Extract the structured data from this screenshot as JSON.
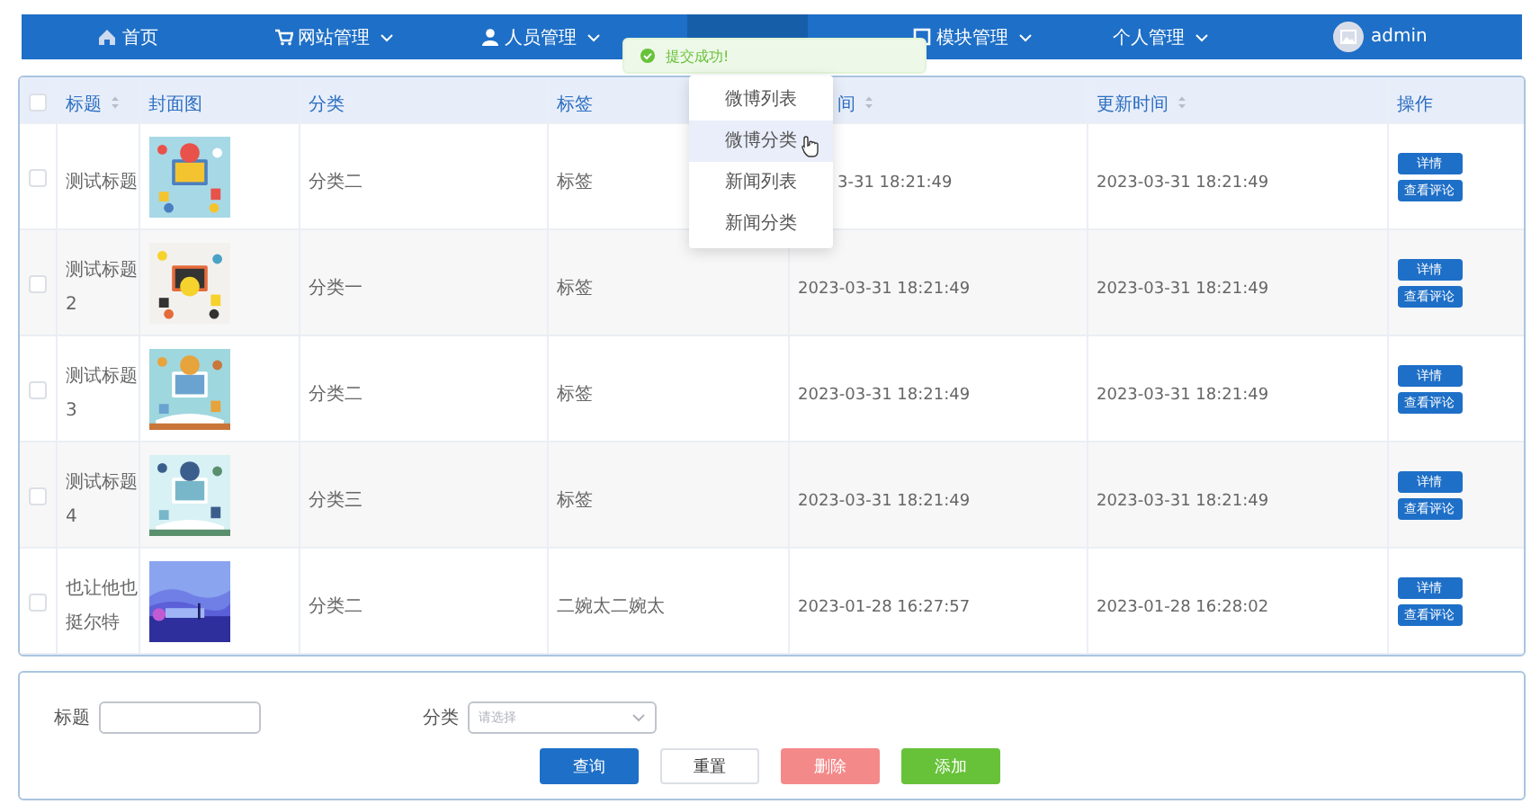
{
  "nav": {
    "items": [
      {
        "label": "首页",
        "dropdown": false,
        "selected": false
      },
      {
        "label": "网站管理",
        "dropdown": true,
        "selected": false
      },
      {
        "label": "人员管理",
        "dropdown": true,
        "selected": false
      },
      {
        "selected": true
      },
      {
        "label": "模块管理",
        "dropdown": true,
        "selected": false
      },
      {
        "label": "个人管理",
        "dropdown": true,
        "selected": false
      }
    ],
    "user": {
      "name": "admin"
    }
  },
  "toast": {
    "message": "提交成功!"
  },
  "dropdown": {
    "items": [
      {
        "label": "微博列表",
        "selected": false
      },
      {
        "label": "微博分类",
        "selected": true
      },
      {
        "label": "新闻列表",
        "selected": false
      },
      {
        "label": "新闻分类",
        "selected": false
      }
    ]
  },
  "table": {
    "header_checked": false,
    "columns": [
      {
        "label": "标题",
        "sortable": true
      },
      {
        "label": "封面图",
        "sortable": false
      },
      {
        "label": "分类",
        "sortable": false
      },
      {
        "label": "标签",
        "sortable": false
      },
      {
        "label": "间",
        "sortable": true
      },
      {
        "label": "更新时间",
        "sortable": true
      },
      {
        "label": "操作",
        "sortable": false
      }
    ],
    "rows": [
      {
        "checked": false,
        "title": "测试标题",
        "category": "分类二",
        "tag": "标签",
        "created": "3-31 18:21:49",
        "updated": "2023-03-31 18:21:49",
        "actions": [
          "详情",
          "查看评论"
        ]
      },
      {
        "checked": false,
        "title": "测试标题2",
        "category": "分类一",
        "tag": "标签",
        "created": "2023-03-31 18:21:49",
        "updated": "2023-03-31 18:21:49",
        "actions": [
          "详情",
          "查看评论"
        ]
      },
      {
        "checked": false,
        "title": "测试标题3",
        "category": "分类二",
        "tag": "标签",
        "created": "2023-03-31 18:21:49",
        "updated": "2023-03-31 18:21:49",
        "actions": [
          "详情",
          "查看评论"
        ]
      },
      {
        "checked": false,
        "title": "测试标题4",
        "category": "分类三",
        "tag": "标签",
        "created": "2023-03-31 18:21:49",
        "updated": "2023-03-31 18:21:49",
        "actions": [
          "详情",
          "查看评论"
        ]
      },
      {
        "checked": false,
        "title": "也让他也挺尔特",
        "category": "分类二",
        "tag": "二婉太二婉太",
        "created": "2023-01-28 16:27:57",
        "updated": "2023-01-28 16:28:02",
        "actions": [
          "详情",
          "查看评论"
        ]
      }
    ]
  },
  "search": {
    "fields": [
      {
        "label": "标题",
        "kind": "input"
      },
      {
        "label": "分类",
        "kind": "select",
        "placeholder": "请选择"
      }
    ],
    "buttons": [
      {
        "label": "查询",
        "kind": "primary"
      },
      {
        "label": "重置",
        "kind": "default"
      },
      {
        "label": "删除",
        "kind": "danger"
      },
      {
        "label": "添加",
        "kind": "success"
      }
    ]
  }
}
